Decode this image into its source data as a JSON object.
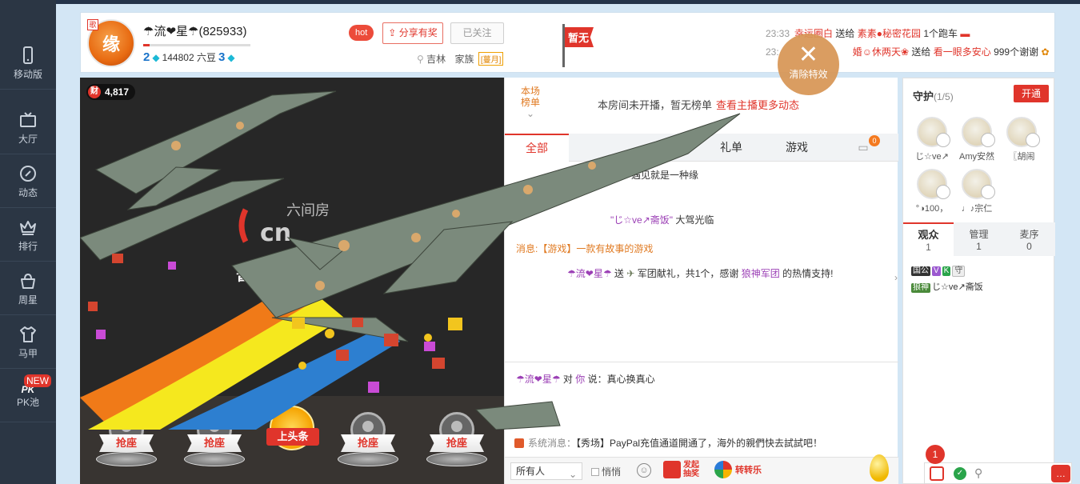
{
  "nav": {
    "items": [
      {
        "label": "移动版",
        "icon": "mobile-icon"
      },
      {
        "label": "大厅",
        "icon": "tv-icon"
      },
      {
        "label": "动态",
        "icon": "compass-icon"
      },
      {
        "label": "排行",
        "icon": "crown-icon"
      },
      {
        "label": "周星",
        "icon": "basket-icon"
      },
      {
        "label": "马甲",
        "icon": "shirt-icon"
      },
      {
        "label": "PK池",
        "icon": "pk-icon"
      }
    ],
    "pk_logo": "PK",
    "new_badge": "NEW"
  },
  "header": {
    "avatar_text": "缘",
    "avatar_badge": "歌",
    "host_name": "☂流❤星☂(825933)",
    "level_left": "2",
    "beans": "144802 六豆",
    "level_right": "3",
    "hot_tag": "hot",
    "share_button": "分享有奖",
    "follow_button": "已关注",
    "location": "吉林",
    "family_label": "家族",
    "family_tag": "[蔓月]",
    "flag_text": "暂无"
  },
  "feed": [
    {
      "time": "23:33",
      "sender": "幸运圈白",
      "action": "送给",
      "receiver": "素素●秘密花园",
      "gift": "1个跑车"
    },
    {
      "time": "23:",
      "sender": "婚☺休两天❀",
      "action": "送给",
      "receiver": "看一眼多安心",
      "gift": "999个谢谢"
    }
  ],
  "clear_effects": {
    "x": "✕",
    "label": "清除特效"
  },
  "video": {
    "wealth_icon": "财",
    "wealth_value": "4,817",
    "watermark": "六间房",
    "offline_text": "暂无",
    "seats": [
      {
        "label": "抢座"
      },
      {
        "label": "抢座"
      },
      {
        "label": "抢座"
      },
      {
        "label": "抢座"
      }
    ],
    "headline_label": "上头条"
  },
  "chat": {
    "rank_label_1": "本场",
    "rank_label_2": "榜单",
    "rank_msg": "本房间未开播，暂无榜单",
    "rank_link": "查看主播更多动态",
    "tabs": [
      "全部",
      "礼单",
      "游戏"
    ],
    "car_badge": "0",
    "messages": {
      "m1": "遇见就是一种缘",
      "m2_name": "\"じ☆ve↗斋饭\"",
      "m2_text": "大驾光临",
      "m3_prefix": "消息:",
      "m3_text": "【游戏】一款有故事的游戏",
      "m4_sender": "☂流❤星☂",
      "m4_action": "送",
      "m4_gift": "军团献礼，共1个，感谢",
      "m4_target": "狼神军团",
      "m4_tail": "的热情支持!"
    },
    "private": {
      "from": "☂流❤星☂",
      "mid": "对",
      "to": "你",
      "says": "说：",
      "text": "真心换真心"
    },
    "system": {
      "prefix": "系统消息：",
      "text": "【秀场】PayPal充值通道開通了，海外的親們快去試試吧！"
    },
    "bottom": {
      "target": "所有人",
      "whisper": "悄悄",
      "lottery_1": "发起",
      "lottery_2": "抽奖",
      "spin": "转转乐"
    }
  },
  "guard": {
    "title": "守护",
    "count": "(1/5)",
    "open_button": "开通",
    "members": [
      {
        "name": "じ☆ve↗"
      },
      {
        "name": "Amy安然"
      },
      {
        "name": "〖胡闹"
      },
      {
        "name": "°◑100，"
      },
      {
        "name": "♩♪宗仁"
      }
    ],
    "tabs": [
      {
        "label": "观众",
        "count": "1"
      },
      {
        "label": "管理",
        "count": "1"
      },
      {
        "label": "麦序",
        "count": "0"
      }
    ],
    "audience": {
      "badge_1": "国公",
      "badge_2": "V",
      "badge_3": "K",
      "badge_4": "守",
      "badge_5": "狼神",
      "name": "じ☆ve↗斋饭"
    }
  },
  "bottom_bar": {
    "mail_badge": "1",
    "ok": "✓",
    "zoom": "⚲",
    "chat": "…"
  }
}
